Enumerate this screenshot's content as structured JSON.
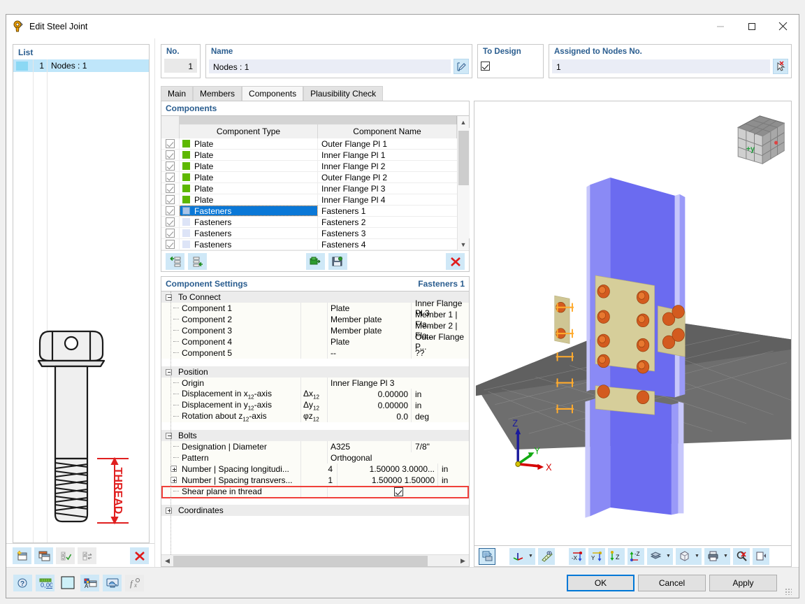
{
  "window": {
    "title": "Edit Steel Joint",
    "icon": "bolt-icon",
    "minimize": "—",
    "maximize": "□",
    "close": "✕"
  },
  "left": {
    "list_caption": "List",
    "items": [
      {
        "no": "1",
        "label": "Nodes : 1"
      }
    ],
    "toolbar": [
      {
        "name": "new-item-button",
        "glyph": "new"
      },
      {
        "name": "copy-item-button",
        "glyph": "copy"
      },
      {
        "name": "check-all-button",
        "glyph": "checkall"
      },
      {
        "name": "invert-selection-button",
        "glyph": "invert"
      },
      {
        "name": "delete-item-button",
        "glyph": "delete"
      }
    ],
    "figure": {
      "label": "THREAD",
      "name": "bolt-thread-diagram"
    }
  },
  "header": {
    "no_caption": "No.",
    "no_value": "1",
    "name_caption": "Name",
    "name_value": "Nodes : 1",
    "edit_name_icon": "edit-pencil-icon",
    "to_design_caption": "To Design",
    "to_design_checked": true,
    "assigned_caption": "Assigned to Nodes No.",
    "assigned_value": "1",
    "pick_icon": "pick-node-icon"
  },
  "tabs": [
    {
      "label": "Main",
      "active": false
    },
    {
      "label": "Members",
      "active": false
    },
    {
      "label": "Components",
      "active": true
    },
    {
      "label": "Plausibility Check",
      "active": false
    }
  ],
  "components": {
    "caption": "Components",
    "columns": [
      "Component Type",
      "Component Name"
    ],
    "rows": [
      {
        "checked": true,
        "color": "#5db800",
        "type": "Plate",
        "name": "Outer Flange Pl 1",
        "selected": false
      },
      {
        "checked": true,
        "color": "#5db800",
        "type": "Plate",
        "name": "Inner Flange Pl 1",
        "selected": false
      },
      {
        "checked": true,
        "color": "#5db800",
        "type": "Plate",
        "name": "Inner Flange Pl 2",
        "selected": false
      },
      {
        "checked": true,
        "color": "#5db800",
        "type": "Plate",
        "name": "Outer Flange Pl 2",
        "selected": false
      },
      {
        "checked": true,
        "color": "#5db800",
        "type": "Plate",
        "name": "Inner Flange Pl 3",
        "selected": false
      },
      {
        "checked": true,
        "color": "#5db800",
        "type": "Plate",
        "name": "Inner Flange Pl 4",
        "selected": false
      },
      {
        "checked": true,
        "color": "#aac4e8",
        "type": "Fasteners",
        "name": "Fasteners 1",
        "selected": true
      },
      {
        "checked": true,
        "color": "#dde4f7",
        "type": "Fasteners",
        "name": "Fasteners 2",
        "selected": false
      },
      {
        "checked": true,
        "color": "#dde4f7",
        "type": "Fasteners",
        "name": "Fasteners 3",
        "selected": false
      },
      {
        "checked": true,
        "color": "#dde4f7",
        "type": "Fasteners",
        "name": "Fasteners 4",
        "selected": false
      }
    ],
    "toolbar": [
      {
        "name": "insert-component-before-button",
        "glyph": "ins-before"
      },
      {
        "name": "insert-component-after-button",
        "glyph": "ins-after"
      },
      {
        "name": "import-component-button",
        "glyph": "import"
      },
      {
        "name": "save-component-button",
        "glyph": "save"
      },
      {
        "name": "delete-component-button",
        "glyph": "delete"
      }
    ]
  },
  "settings": {
    "caption": "Component Settings",
    "context": "Fasteners 1",
    "groups": [
      {
        "label": "To Connect",
        "expanded": true,
        "rows": [
          {
            "key": "Component 1",
            "sym": "",
            "v": "Plate",
            "v2": "Inner Flange Pl 3"
          },
          {
            "key": "Component 2",
            "sym": "",
            "v": "Member plate",
            "v2": "Member 1 | Fla..."
          },
          {
            "key": "Component 3",
            "sym": "",
            "v": "Member plate",
            "v2": "Member 2 | Fla..."
          },
          {
            "key": "Component 4",
            "sym": "",
            "v": "Plate",
            "v2": "Outer Flange P..."
          },
          {
            "key": "Component 5",
            "sym": "",
            "v": "--",
            "v2": "??"
          }
        ]
      },
      {
        "label": "Position",
        "expanded": true,
        "rows": [
          {
            "key": "Origin",
            "sym": "",
            "v": "Inner Flange Pl 3",
            "v2": "",
            "span": true
          },
          {
            "key": "Displacement in x12-axis",
            "sym": "Δx12",
            "v": "0.00000",
            "v2": "in",
            "num": true
          },
          {
            "key": "Displacement in y12-axis",
            "sym": "Δy12",
            "v": "0.00000",
            "v2": "in",
            "num": true
          },
          {
            "key": "Rotation about z12-axis",
            "sym": "φz12",
            "v": "0.0",
            "v2": "deg",
            "num": true
          }
        ]
      },
      {
        "label": "Bolts",
        "expanded": true,
        "rows": [
          {
            "key": "Designation | Diameter",
            "v": "A325",
            "v2": "7/8\""
          },
          {
            "key": "Pattern",
            "v": "Orthogonal",
            "v2": "",
            "span": true
          },
          {
            "key": "Number | Spacing longitudi...",
            "n": "4",
            "spacing": "1.50000 3.0000...",
            "unit": "in",
            "expandable": true
          },
          {
            "key": "Number | Spacing transvers...",
            "n": "1",
            "spacing": "1.50000 1.50000",
            "unit": "in",
            "expandable": true
          },
          {
            "key": "Shear plane in thread",
            "checkbox": true,
            "checked": true,
            "highlighted": true
          }
        ]
      },
      {
        "label": "Coordinates",
        "expanded": false,
        "rows": []
      }
    ]
  },
  "view3d": {
    "nav_cube_label": "+y",
    "axis_labels": {
      "x": "X",
      "y": "Y",
      "z": "Z"
    },
    "colors": {
      "beam": "#6B6BF0",
      "plate": "#D6CE9A",
      "bolt": "#D35B1F",
      "floor": "#6e6e6e",
      "axis_x": "#d40000",
      "axis_y": "#11a911",
      "axis_z": "#1a1a9c",
      "dimension": "#ffab2e"
    },
    "toolbar": [
      {
        "name": "render-mode-button",
        "glyph": "render",
        "selected": true
      },
      {
        "name": "coordinate-system-button",
        "glyph": "axes",
        "caret": true
      },
      {
        "name": "measure-button",
        "glyph": "ruler"
      },
      {
        "name": "view-minus-x-button",
        "glyph": "-X"
      },
      {
        "name": "view-y-button",
        "glyph": "Y"
      },
      {
        "name": "view-z-button",
        "glyph": "Z"
      },
      {
        "name": "view-minus-z-button",
        "glyph": "-Z"
      },
      {
        "name": "layers-button",
        "glyph": "layers",
        "caret": true
      },
      {
        "name": "box-view-button",
        "glyph": "box",
        "caret": true
      },
      {
        "name": "print-button",
        "glyph": "printer",
        "caret": true
      },
      {
        "name": "zoom-reset-button",
        "glyph": "zoomreset"
      },
      {
        "name": "panel-toggle-button",
        "glyph": "panel"
      }
    ]
  },
  "bottom": {
    "toolbar": [
      {
        "name": "help-button",
        "glyph": "help"
      },
      {
        "name": "units-button",
        "glyph": "units"
      },
      {
        "name": "color-swatch-button",
        "glyph": "swatch"
      },
      {
        "name": "display-properties-button",
        "glyph": "display"
      },
      {
        "name": "graphic-button",
        "glyph": "graphic"
      },
      {
        "name": "function-button",
        "glyph": "fx"
      }
    ],
    "ok": "OK",
    "cancel": "Cancel",
    "apply": "Apply"
  }
}
